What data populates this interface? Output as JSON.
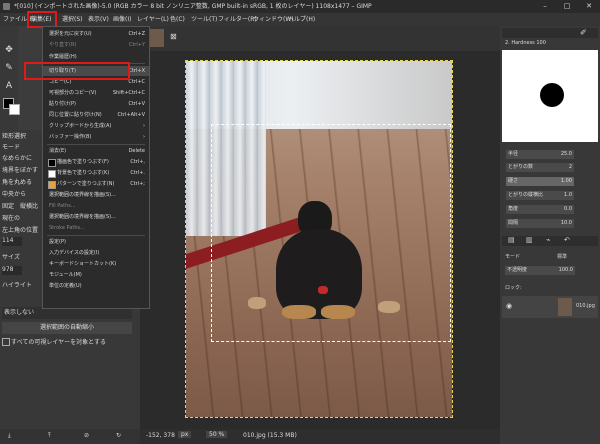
{
  "window": {
    "title": "*[010] (インポートされた画像)-5.0 (RGB カラー 8 bit ノンリニア整数, GMP built-in sRGB, 1 枚のレイヤー) 1108x1477 – GIMP",
    "controls": [
      "–",
      "□",
      "✕"
    ]
  },
  "menubar": [
    "ファイル(F)",
    "編集(E)",
    "選択(S)",
    "表示(V)",
    "画像(I)",
    "レイヤー(L)",
    "色(C)",
    "ツール(T)",
    "フィルター(R)",
    "ウィンドウ(W)",
    "ヘルプ(H)"
  ],
  "edit_menu": {
    "items": [
      {
        "label": "選択を元に戻す(U)",
        "shortcut": "Ctrl+Z",
        "state": "normal"
      },
      {
        "label": "やり直す(R)",
        "shortcut": "Ctrl+Y",
        "state": "disabled"
      },
      {
        "label": "作業履歴(H)",
        "shortcut": "",
        "state": "normal"
      },
      {
        "label": "切り取り(T)",
        "shortcut": "Ctrl+X",
        "state": "highlighted"
      },
      {
        "label": "コピー(C)",
        "shortcut": "Ctrl+C",
        "state": "normal"
      },
      {
        "label": "可視部分のコピー(V)",
        "shortcut": "Shift+Ctrl+C",
        "state": "normal"
      },
      {
        "label": "貼り付け(P)",
        "shortcut": "Ctrl+V",
        "state": "normal"
      },
      {
        "label": "同じ位置に貼り付け(N)",
        "shortcut": "Ctrl+Alt+V",
        "state": "normal"
      },
      {
        "label": "クリップボードから生成(A)",
        "shortcut": "›",
        "state": "normal"
      },
      {
        "label": "バッファー操作(B)",
        "shortcut": "›",
        "state": "normal"
      },
      {
        "label": "消去(E)",
        "shortcut": "Delete",
        "state": "normal"
      },
      {
        "label": "描画色で塗りつぶす(F)",
        "shortcut": "Ctrl+,",
        "state": "normal"
      },
      {
        "label": "背景色で塗りつぶす(K)",
        "shortcut": "Ctrl+.",
        "state": "normal"
      },
      {
        "label": "パターンで塗りつぶす(N)",
        "shortcut": "Ctrl+;",
        "state": "normal"
      },
      {
        "label": "選択範囲の境界線を描画(S)...",
        "shortcut": "",
        "state": "normal"
      },
      {
        "label": "Fill Paths...",
        "shortcut": "",
        "state": "disabled"
      },
      {
        "label": "選択範囲の境界線を描画(S)...",
        "shortcut": "",
        "state": "normal"
      },
      {
        "label": "Stroke Paths...",
        "shortcut": "",
        "state": "disabled"
      },
      {
        "label": "設定(P)",
        "shortcut": "",
        "state": "normal"
      },
      {
        "label": "入力デバイスの設定(I)",
        "shortcut": "",
        "state": "normal"
      },
      {
        "label": "キーボードショートカット(K)",
        "shortcut": "",
        "state": "normal"
      },
      {
        "label": "モジュール(M)",
        "shortcut": "",
        "state": "normal"
      },
      {
        "label": "単位の定義(U)",
        "shortcut": "",
        "state": "normal"
      }
    ]
  },
  "left_dock": {
    "labels": [
      "矩形選択",
      "モード",
      "なめらかに",
      "境界をぼかす",
      "角を丸める",
      "中央から",
      "固定",
      "縦横比",
      "現在の",
      "左上角の位置",
      "114",
      "サイズ",
      "978",
      "ハイライト"
    ],
    "show_label": "表示しない",
    "action_button": "選択範囲の自動縮小",
    "checkbox_label": "すべての可視レイヤーを対象とする"
  },
  "status": {
    "coords": "-152, 378",
    "unit": "px",
    "zoom": "50 %",
    "file": "010.jpg (15.3 MB)"
  },
  "right_dock": {
    "brush_name": "2. Hardness 100",
    "sliders": [
      {
        "label": "半径",
        "value": "25.0"
      },
      {
        "label": "とがりの数",
        "value": "2"
      },
      {
        "label": "硬さ",
        "value": "1.00"
      },
      {
        "label": "とがりの縦横比",
        "value": "1.0"
      },
      {
        "label": "角度",
        "value": "0.0"
      },
      {
        "label": "間隔",
        "value": "10.0"
      }
    ],
    "mode_label": "モード",
    "mode_value": "標準",
    "opacity_label": "不透明度",
    "opacity_value": "100.0",
    "lock_label": "ロック:",
    "layer_name": "010.jpg"
  }
}
